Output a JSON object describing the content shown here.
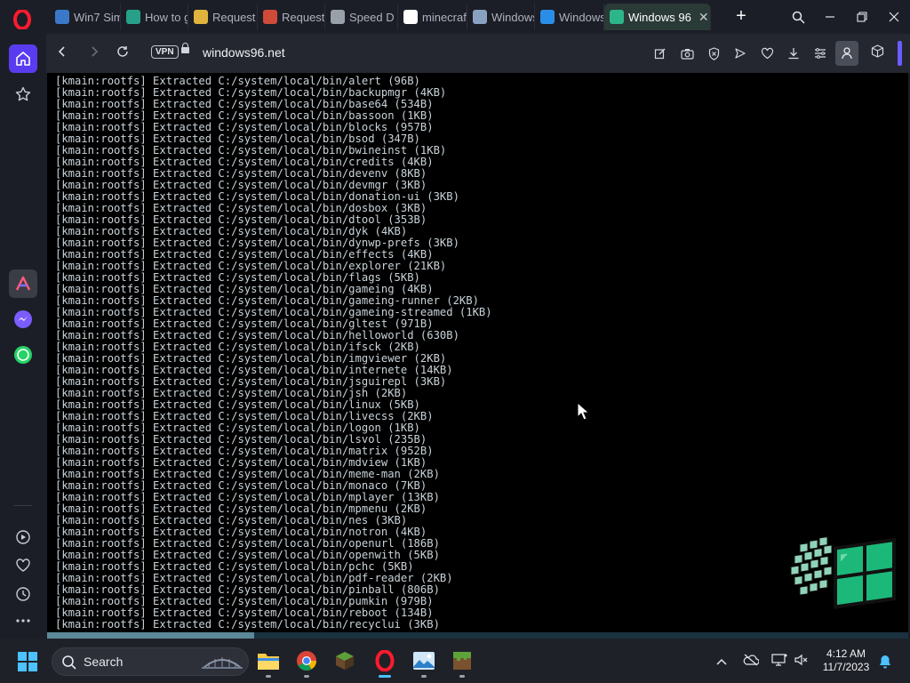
{
  "browser": {
    "tabs": [
      {
        "label": "Win7 Sim",
        "favicon": "#3b78c8",
        "active": false
      },
      {
        "label": "How to g",
        "favicon": "#27a08a",
        "active": false
      },
      {
        "label": "Request",
        "favicon": "#e0b43c",
        "active": false
      },
      {
        "label": "Request",
        "favicon": "#d04a3a",
        "active": false
      },
      {
        "label": "Speed D",
        "favicon": "#9aa0aa",
        "active": false
      },
      {
        "label": "minecraft",
        "favicon": "#ffffff",
        "active": false
      },
      {
        "label": "Windows",
        "favicon": "#8aa0c0",
        "active": false
      },
      {
        "label": "Windows",
        "favicon": "#2a8ee8",
        "active": false
      },
      {
        "label": "Windows 96",
        "favicon": "#2db58a",
        "active": true
      }
    ],
    "address": {
      "vpn_label": "VPN",
      "url": "windows96.net"
    },
    "accent_color": "#5a3cf0"
  },
  "terminal": {
    "lines": [
      "[kmain:rootfs] Extracted C:/system/local/bin/alert (96B)",
      "[kmain:rootfs] Extracted C:/system/local/bin/backupmgr (4KB)",
      "[kmain:rootfs] Extracted C:/system/local/bin/base64 (534B)",
      "[kmain:rootfs] Extracted C:/system/local/bin/bassoon (1KB)",
      "[kmain:rootfs] Extracted C:/system/local/bin/blocks (957B)",
      "[kmain:rootfs] Extracted C:/system/local/bin/bsod (347B)",
      "[kmain:rootfs] Extracted C:/system/local/bin/bwineinst (1KB)",
      "[kmain:rootfs] Extracted C:/system/local/bin/credits (4KB)",
      "[kmain:rootfs] Extracted C:/system/local/bin/devenv (8KB)",
      "[kmain:rootfs] Extracted C:/system/local/bin/devmgr (3KB)",
      "[kmain:rootfs] Extracted C:/system/local/bin/donation-ui (3KB)",
      "[kmain:rootfs] Extracted C:/system/local/bin/dosbox (3KB)",
      "[kmain:rootfs] Extracted C:/system/local/bin/dtool (353B)",
      "[kmain:rootfs] Extracted C:/system/local/bin/dyk (4KB)",
      "[kmain:rootfs] Extracted C:/system/local/bin/dynwp-prefs (3KB)",
      "[kmain:rootfs] Extracted C:/system/local/bin/effects (4KB)",
      "[kmain:rootfs] Extracted C:/system/local/bin/explorer (21KB)",
      "[kmain:rootfs] Extracted C:/system/local/bin/flags (5KB)",
      "[kmain:rootfs] Extracted C:/system/local/bin/gameing (4KB)",
      "[kmain:rootfs] Extracted C:/system/local/bin/gameing-runner (2KB)",
      "[kmain:rootfs] Extracted C:/system/local/bin/gameing-streamed (1KB)",
      "[kmain:rootfs] Extracted C:/system/local/bin/gltest (971B)",
      "[kmain:rootfs] Extracted C:/system/local/bin/helloworld (630B)",
      "[kmain:rootfs] Extracted C:/system/local/bin/ifsck (2KB)",
      "[kmain:rootfs] Extracted C:/system/local/bin/imgviewer (2KB)",
      "[kmain:rootfs] Extracted C:/system/local/bin/internete (14KB)",
      "[kmain:rootfs] Extracted C:/system/local/bin/jsguirepl (3KB)",
      "[kmain:rootfs] Extracted C:/system/local/bin/jsh (2KB)",
      "[kmain:rootfs] Extracted C:/system/local/bin/linux (5KB)",
      "[kmain:rootfs] Extracted C:/system/local/bin/livecss (2KB)",
      "[kmain:rootfs] Extracted C:/system/local/bin/logon (1KB)",
      "[kmain:rootfs] Extracted C:/system/local/bin/lsvol (235B)",
      "[kmain:rootfs] Extracted C:/system/local/bin/matrix (952B)",
      "[kmain:rootfs] Extracted C:/system/local/bin/mdview (1KB)",
      "[kmain:rootfs] Extracted C:/system/local/bin/meme-man (2KB)",
      "[kmain:rootfs] Extracted C:/system/local/bin/monaco (7KB)",
      "[kmain:rootfs] Extracted C:/system/local/bin/mplayer (13KB)",
      "[kmain:rootfs] Extracted C:/system/local/bin/mpmenu (2KB)",
      "[kmain:rootfs] Extracted C:/system/local/bin/nes (3KB)",
      "[kmain:rootfs] Extracted C:/system/local/bin/notron (4KB)",
      "[kmain:rootfs] Extracted C:/system/local/bin/openurl (186B)",
      "[kmain:rootfs] Extracted C:/system/local/bin/openwith (5KB)",
      "[kmain:rootfs] Extracted C:/system/local/bin/pchc (5KB)",
      "[kmain:rootfs] Extracted C:/system/local/bin/pdf-reader (2KB)",
      "[kmain:rootfs] Extracted C:/system/local/bin/pinball (806B)",
      "[kmain:rootfs] Extracted C:/system/local/bin/pumkin (979B)",
      "[kmain:rootfs] Extracted C:/system/local/bin/reboot (134B)",
      "[kmain:rootfs] Extracted C:/system/local/bin/recyclui (3KB)"
    ],
    "text_color": "#c9d3d9",
    "background": "#000000"
  },
  "taskbar": {
    "search_label": "Search",
    "time": "4:12 AM",
    "date": "11/7/2023",
    "accent_color": "#4cc2ff"
  }
}
